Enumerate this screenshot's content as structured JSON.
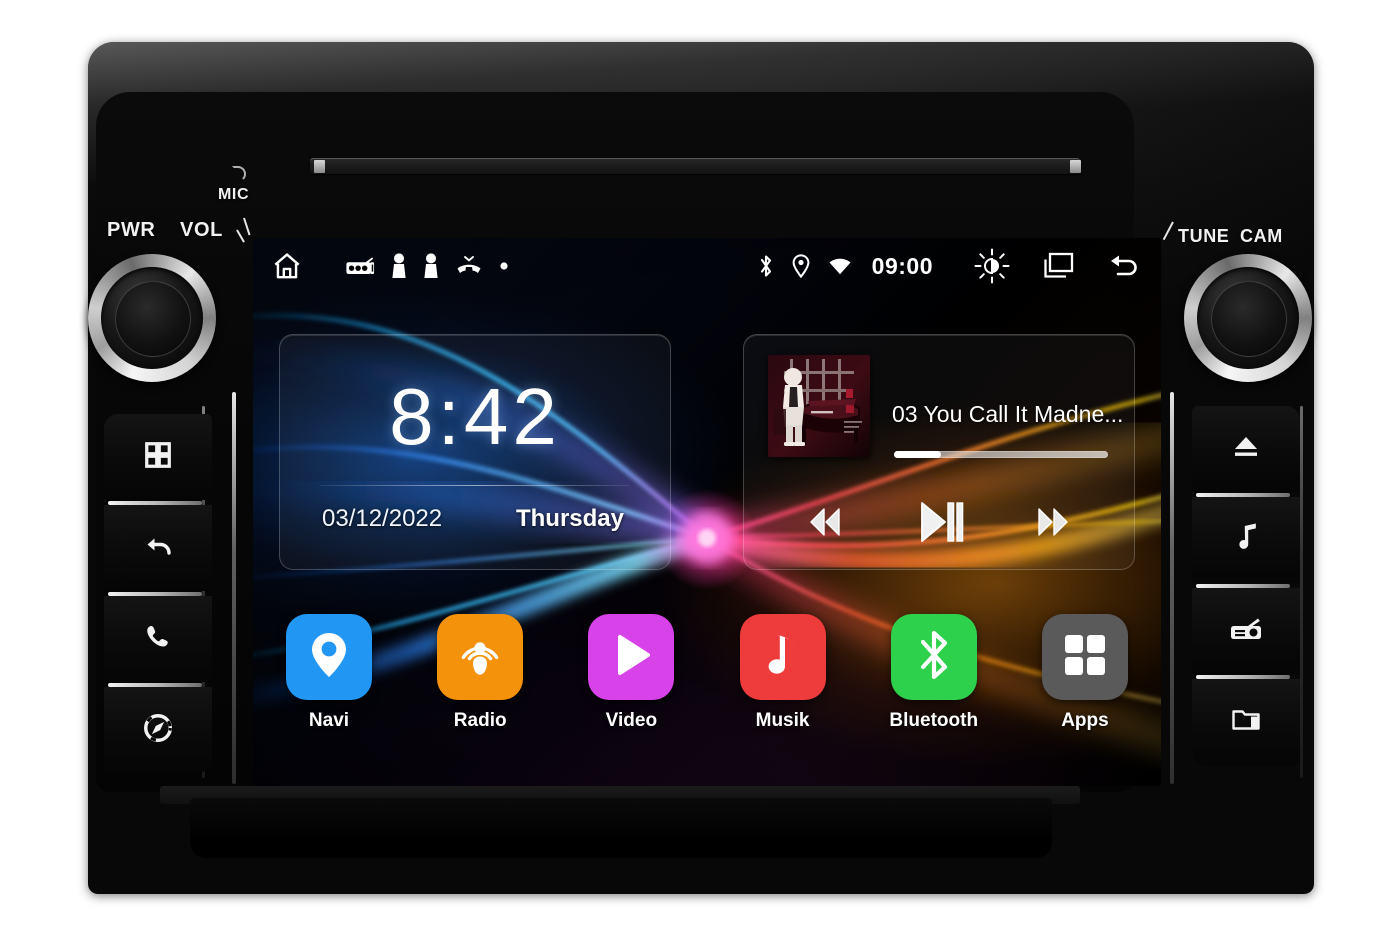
{
  "device": {
    "bezel_labels": {
      "mic": "MIC",
      "pwr": "PWR",
      "vol": "VOL",
      "tune": "TUNE",
      "cam": "CAM"
    },
    "left_buttons": [
      {
        "name": "apps-grid",
        "icon": "grid-icon"
      },
      {
        "name": "back",
        "icon": "back-arrow-icon"
      },
      {
        "name": "phone",
        "icon": "phone-icon"
      },
      {
        "name": "navigation",
        "icon": "compass-icon"
      }
    ],
    "right_buttons": [
      {
        "name": "eject",
        "icon": "eject-icon"
      },
      {
        "name": "music",
        "icon": "music-note-icon"
      },
      {
        "name": "radio",
        "icon": "radio-icon"
      },
      {
        "name": "folder",
        "icon": "folder-icon"
      }
    ],
    "knobs": [
      {
        "name": "power-volume-knob",
        "labels": "PWR / VOL"
      },
      {
        "name": "tune-cam-knob",
        "labels": "TUNE / CAM"
      }
    ]
  },
  "screen": {
    "status_bar": {
      "left_icons": [
        {
          "name": "home-icon",
          "label": "Home"
        },
        {
          "name": "radio-icon",
          "label": "Radio"
        },
        {
          "name": "person-icon",
          "label": "Contacts"
        },
        {
          "name": "person-icon",
          "label": "Contacts"
        },
        {
          "name": "missed-call-icon",
          "label": "Missed call"
        },
        {
          "name": "dot-icon",
          "label": "More"
        }
      ],
      "right_icons": [
        {
          "name": "bluetooth-icon",
          "label": "Bluetooth"
        },
        {
          "name": "location-pin-icon",
          "label": "GPS"
        },
        {
          "name": "wifi-icon",
          "label": "Wi-Fi"
        }
      ],
      "clock": "09:00",
      "nav_icons": [
        {
          "name": "brightness-icon",
          "label": "Brightness"
        },
        {
          "name": "recent-apps-icon",
          "label": "Recent apps"
        },
        {
          "name": "back-icon",
          "label": "Back"
        }
      ]
    },
    "clock_widget": {
      "time": "8:42",
      "date": "03/12/2022",
      "weekday": "Thursday"
    },
    "music_widget": {
      "track_title": "03 You Call It Madne...",
      "progress_percent": 22,
      "album_art_name": "album-art",
      "controls": [
        {
          "name": "previous-track-button",
          "icon": "rewind-icon"
        },
        {
          "name": "play-pause-button",
          "icon": "play-pause-icon"
        },
        {
          "name": "next-track-button",
          "icon": "fast-forward-icon"
        }
      ]
    },
    "apps": [
      {
        "name": "navi",
        "label": "Navi",
        "icon": "location-pin-icon",
        "color": "#2196f3"
      },
      {
        "name": "radio",
        "label": "Radio",
        "icon": "podcast-icon",
        "color": "#f5920b"
      },
      {
        "name": "video",
        "label": "Video",
        "icon": "play-icon",
        "color": "#d743e8"
      },
      {
        "name": "musik",
        "label": "Musik",
        "icon": "music-note-icon",
        "color": "#ee3b3b"
      },
      {
        "name": "bluetooth",
        "label": "Bluetooth",
        "icon": "bluetooth-icon",
        "color": "#2ed14b"
      },
      {
        "name": "apps",
        "label": "Apps",
        "icon": "grid-icon",
        "color": "#5a5a5a"
      }
    ]
  },
  "colors": {
    "screen_bg": "#000000",
    "accent_blue": "#2196f3",
    "accent_orange": "#f5920b",
    "accent_magenta": "#d743e8",
    "accent_red": "#ee3b3b",
    "accent_green": "#2ed14b",
    "accent_gray": "#5a5a5a",
    "text_primary": "#ffffff"
  }
}
